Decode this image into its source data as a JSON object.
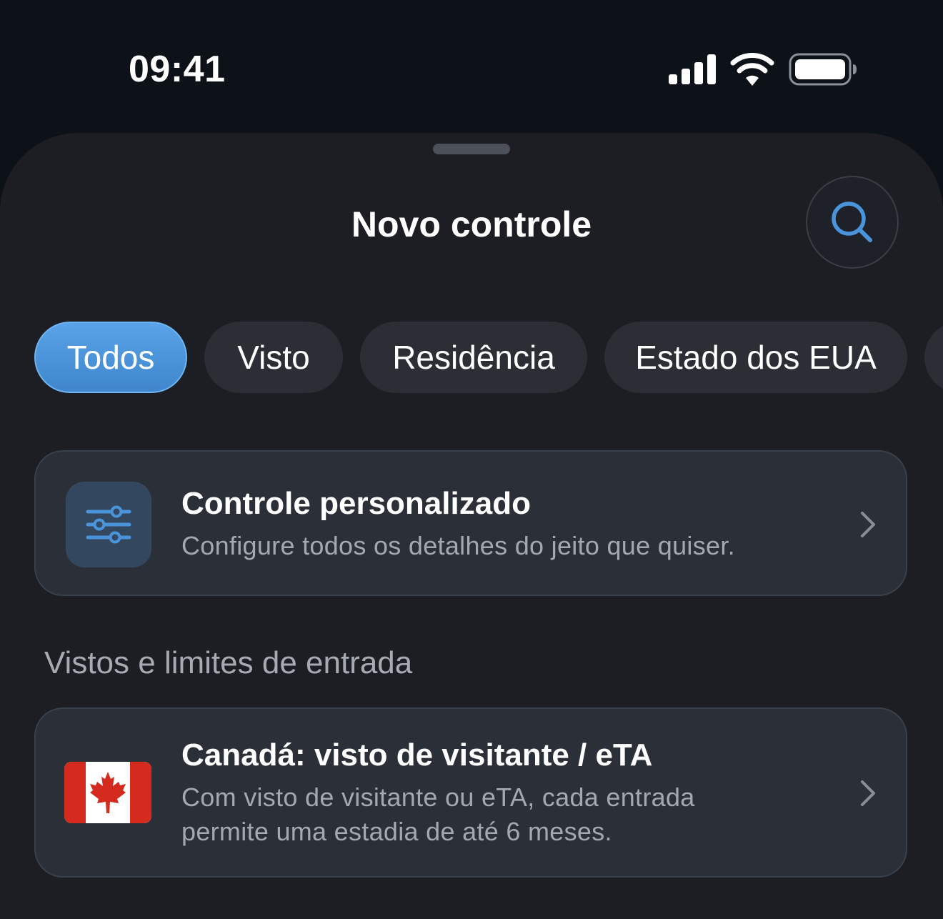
{
  "status_bar": {
    "time": "09:41",
    "icons": [
      "signal-icon",
      "wifi-icon",
      "battery-icon"
    ]
  },
  "sheet": {
    "title": "Novo controle",
    "search_icon": "search-icon"
  },
  "filters": {
    "chips": [
      {
        "label": "Todos",
        "active": true
      },
      {
        "label": "Visto",
        "active": false
      },
      {
        "label": "Residência",
        "active": false
      },
      {
        "label": "Estado dos EUA",
        "active": false
      }
    ]
  },
  "custom_card": {
    "title": "Controle personalizado",
    "subtitle": "Configure todos os detalhes do jeito que quiser.",
    "icon": "sliders-icon"
  },
  "section": {
    "title": "Vistos e limites de entrada"
  },
  "canada_card": {
    "title": "Canadá: visto de visitante / eTA",
    "subtitle_line1": "Com visto de visitante ou eTA, cada entrada",
    "subtitle_line2": "permite uma estadia de até 6 meses.",
    "icon": "canada-flag-icon"
  },
  "colors": {
    "accent": "#4a94dc",
    "background": "#1c1e24",
    "card": "#2a2f38",
    "flag_red": "#d52b1e"
  }
}
